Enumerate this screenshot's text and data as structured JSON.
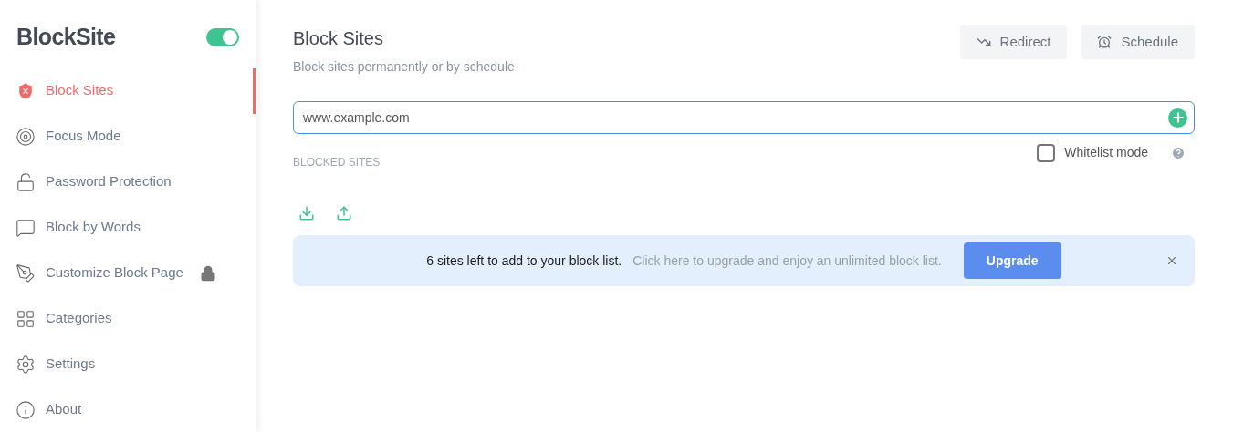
{
  "sidebar": {
    "logo": "BlockSite",
    "enabled": true,
    "items": [
      {
        "label": "Block Sites",
        "selected": true,
        "locked": false
      },
      {
        "label": "Focus Mode",
        "selected": false,
        "locked": false
      },
      {
        "label": "Password Protection",
        "selected": false,
        "locked": false
      },
      {
        "label": "Block by Words",
        "selected": false,
        "locked": false
      },
      {
        "label": "Customize Block Page",
        "selected": false,
        "locked": true
      },
      {
        "label": "Categories",
        "selected": false,
        "locked": false
      },
      {
        "label": "Settings",
        "selected": false,
        "locked": false
      },
      {
        "label": "About",
        "selected": false,
        "locked": false
      }
    ]
  },
  "header": {
    "title": "Block Sites",
    "subtitle": "Block sites permanently or by schedule",
    "buttons": [
      "Redirect",
      "Schedule"
    ]
  },
  "site_input": {
    "value": "www.example.com"
  },
  "blocked_sites_label": "BLOCKED SITES",
  "whitelist": {
    "label": "Whitelist mode",
    "checked": false
  },
  "banner": {
    "message": "6 sites left to add to your block list.",
    "hint": "Click here to upgrade and enjoy an unlimited block list.",
    "button": "Upgrade"
  }
}
